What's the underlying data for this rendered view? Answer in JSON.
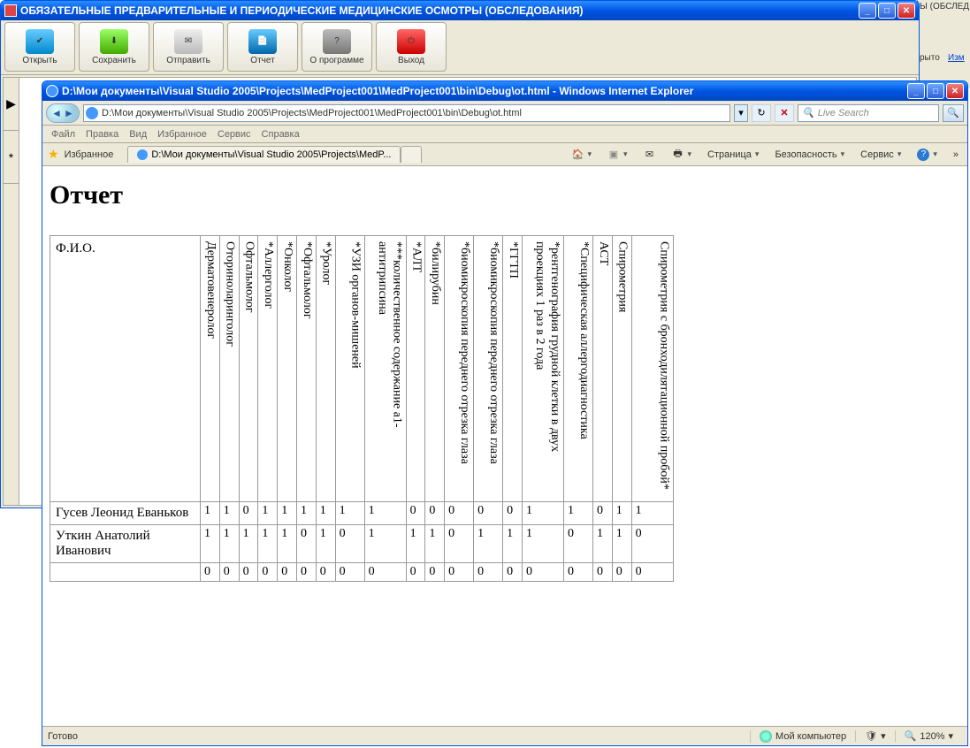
{
  "background": {
    "rightTxt1": "Ы (ОБСЛЕД",
    "rightTxt2": "рыто",
    "rightTxt3": "Изм"
  },
  "parent": {
    "title": "ОБЯЗАТЕЛЬНЫЕ ПРЕДВАРИТЕЛЬНЫЕ И ПЕРИОДИЧЕСКИЕ МЕДИЦИНСКИЕ ОСМОТРЫ (ОБСЛЕДОВАНИЯ)",
    "buttons": {
      "open": "Открыть",
      "save": "Сохранить",
      "send": "Отправить",
      "report": "Отчет",
      "about": "О программе",
      "exit": "Выход"
    },
    "tab1": "▶",
    "tab2": "*"
  },
  "ie": {
    "title": "D:\\Мои документы\\Visual Studio 2005\\Projects\\MedProject001\\MedProject001\\bin\\Debug\\ot.html - Windows Internet Explorer",
    "url": "D:\\Мои документы\\Visual Studio 2005\\Projects\\MedProject001\\MedProject001\\bin\\Debug\\ot.html",
    "searchPlaceholder": "Live Search",
    "menu": {
      "file": "Файл",
      "edit": "Правка",
      "view": "Вид",
      "fav": "Избранное",
      "svc": "Сервис",
      "help": "Справка"
    },
    "fav": {
      "label": "Избранное",
      "tab": "D:\\Мои документы\\Visual Studio 2005\\Projects\\MedP..."
    },
    "cmd": {
      "page": "Страница",
      "safety": "Безопасность",
      "tools": "Сервис"
    },
    "status": {
      "ready": "Готово",
      "zone": "Мой компьютер",
      "zoom": "120%"
    }
  },
  "report": {
    "heading": "Отчет",
    "fioHeader": "Ф.И.О.",
    "columns": [
      "Дерматовенеролог",
      "Оториноларинголог",
      "Офтальмолог",
      "*Аллерголог",
      "*Онколог",
      "*Офтальмолог",
      "*Уролог",
      "*УЗИ органов-мишеней",
      "***количественное содержание a1-антитрипсина",
      "*АЛТ",
      "*билирубин",
      "*биомикроскопия переднего отрезка глаза",
      "*биомикроскопия переднего отрезка глаза",
      "*ГГТП",
      "*рентгенография грудной клетки в двух проекциях 1 раз в 2 года",
      "*Специфическая аллергодиагностика",
      "АСТ",
      "Спирометрия",
      "Спирометрия с бронходилятационной пробой*"
    ],
    "rows": [
      {
        "name": "Гусев Леонид Еваньков",
        "v": [
          "1",
          "1",
          "0",
          "1",
          "1",
          "1",
          "1",
          "1",
          "1",
          "0",
          "0",
          "0",
          "0",
          "0",
          "1",
          "1",
          "0",
          "1",
          "1"
        ]
      },
      {
        "name": "Уткин Анатолий Иванович",
        "v": [
          "1",
          "1",
          "1",
          "1",
          "1",
          "0",
          "1",
          "0",
          "1",
          "1",
          "1",
          "0",
          "1",
          "1",
          "1",
          "0",
          "1",
          "1",
          "0"
        ]
      },
      {
        "name": "",
        "v": [
          "0",
          "0",
          "0",
          "0",
          "0",
          "0",
          "0",
          "0",
          "0",
          "0",
          "0",
          "0",
          "0",
          "0",
          "0",
          "0",
          "0",
          "0",
          "0"
        ]
      }
    ]
  }
}
